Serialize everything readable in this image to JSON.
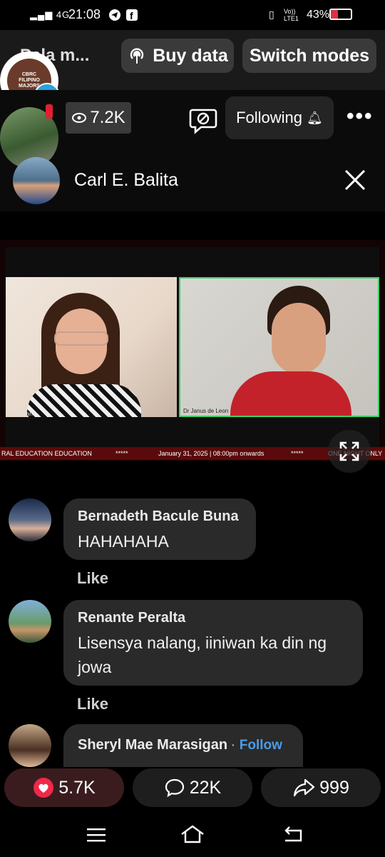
{
  "status_bar": {
    "network": "4G",
    "time": "21:08",
    "volte": "Vo)) LTE1",
    "battery": "43%"
  },
  "top_bar": {
    "page_name": "Pala m...",
    "buy_data_label": "Buy data",
    "switch_modes_label": "Switch modes",
    "badge_text": "CBRC FILIPINO MAJORS"
  },
  "live": {
    "view_count": "7.2K",
    "following_label": "Following",
    "host_name": "Carl E. Balita"
  },
  "video": {
    "left_name_tag": "ah Alvaran",
    "right_name_tag": "Dr Janus de Leon",
    "ticker_left": "RAL EDUCATION EDUCATION",
    "ticker_stars_1": "*****",
    "ticker_date": "January 31, 2025 | 08:00pm onwards",
    "ticker_stars_2": "*****",
    "ticker_right": "ONE NIGHT ONLY"
  },
  "comments": [
    {
      "name": "Bernadeth Bacule Buna",
      "text": "HAHAHAHA",
      "like": "Like"
    },
    {
      "name": "Renante Peralta",
      "text": "Lisensya nalang, iiniwan ka din ng jowa",
      "like": "Like"
    },
    {
      "name": "Sheryl Mae Marasigan",
      "follow": "Follow"
    }
  ],
  "reactions": {
    "likes": "5.7K",
    "comments": "22K",
    "shares": "999"
  },
  "colors": {
    "accent_blue": "#4a9be8",
    "heart_red": "#f0284a",
    "telegram_blue": "#2aa3dc"
  }
}
